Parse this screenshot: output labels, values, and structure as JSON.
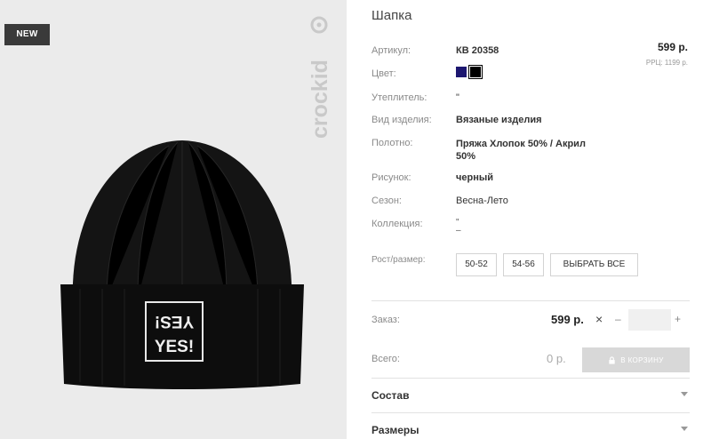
{
  "photo": {
    "badge": "NEW",
    "brand": "crockid",
    "hat_patch": "¡SƎY YES!"
  },
  "product": {
    "title": "Шапка",
    "price": "599 р.",
    "rrp": "РРЦ: 1199 р.",
    "attributes": [
      {
        "label": "Артикул:",
        "value": "КВ 20358"
      },
      {
        "label": "Цвет:",
        "value": ""
      },
      {
        "label": "Утеплитель:",
        "value": "\""
      },
      {
        "label": "Вид изделия:",
        "value": "Вязаные изделия"
      },
      {
        "label": "Полотно:",
        "value": "Пряжа Хлопок 50% / Акрил 50%"
      },
      {
        "label": "Рисунок:",
        "value": "черный"
      },
      {
        "label": "Сезон:",
        "value": "Весна-Лето"
      },
      {
        "label": "Коллекция:",
        "value": "\"\n–"
      }
    ],
    "colors": [
      "#1d1770",
      "#000000"
    ]
  },
  "sizes": {
    "label": "Рост/размер:",
    "options": [
      "50-52",
      "54-56"
    ],
    "select_all": "ВЫБРАТЬ ВСЕ"
  },
  "order": {
    "label": "Заказ:",
    "price": "599 р.",
    "times": "×",
    "minus": "–",
    "plus": "+",
    "qty": ""
  },
  "total": {
    "label": "Всего:",
    "value": "0 р.",
    "cart_button": "В КОРЗИНУ"
  },
  "accordions": [
    "Состав",
    "Размеры"
  ]
}
